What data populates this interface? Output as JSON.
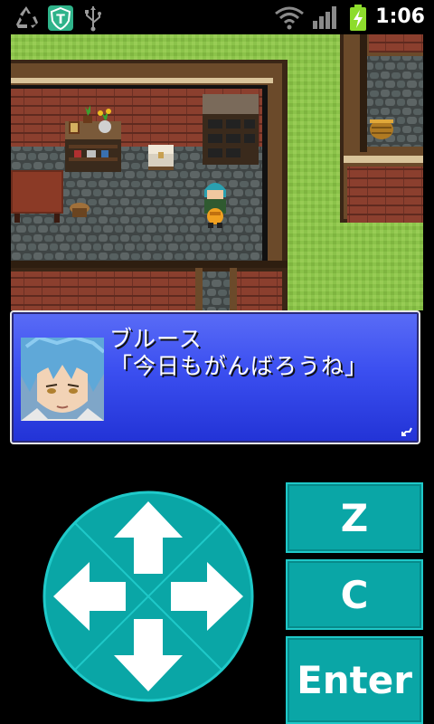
{
  "status_bar": {
    "time": "1:06",
    "icons": [
      "recycle-icon",
      "shield-t-icon",
      "usb-icon",
      "wifi-icon",
      "signal-icon",
      "battery-charging-icon"
    ]
  },
  "dialog": {
    "speaker": "ブルース",
    "line": "「今日もがんばろうね」"
  },
  "controls": {
    "z_label": "Z",
    "c_label": "C",
    "enter_label": "Enter",
    "dpad_arrows": [
      "up-arrow-icon",
      "left-arrow-icon",
      "right-arrow-icon",
      "down-arrow-icon"
    ]
  },
  "colors": {
    "accent": "#0aa6a6",
    "dialog_blue": "#3b4ff0",
    "grass": "#8bc34a"
  }
}
